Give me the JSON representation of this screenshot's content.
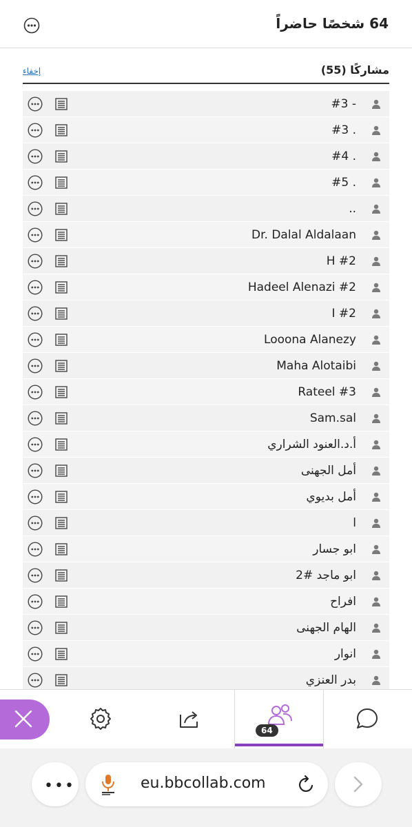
{
  "header": {
    "title": "64 شخصًا حاضراً"
  },
  "section": {
    "title": "مشاركًا (55)",
    "hide_label": "إخفاء"
  },
  "participants": [
    "#3 -",
    "#3 .",
    "#4 .",
    "#5 .",
    "..",
    "Dr. Dalal Aldalaan",
    "H #2",
    "Hadeel Alenazi #2",
    "I #2",
    "Looona Alanezy",
    "Maha Alotaibi",
    "Rateel #3",
    "Sam.sal",
    "أ.د.العنود الشراري",
    "أمل الجهنى",
    "أمل بديوي",
    "ا",
    "ابو جسار",
    "ابو ماجد #2",
    "افراح",
    "الهام الجهنى",
    "انوار",
    "بدر العنزي"
  ],
  "toolbar": {
    "attendee_count_badge": "64"
  },
  "browser": {
    "url": "eu.bbcollab.com"
  },
  "colors": {
    "accent": "#8a3fbf",
    "close_button": "#b46ad8",
    "link": "#1f6fbf"
  }
}
